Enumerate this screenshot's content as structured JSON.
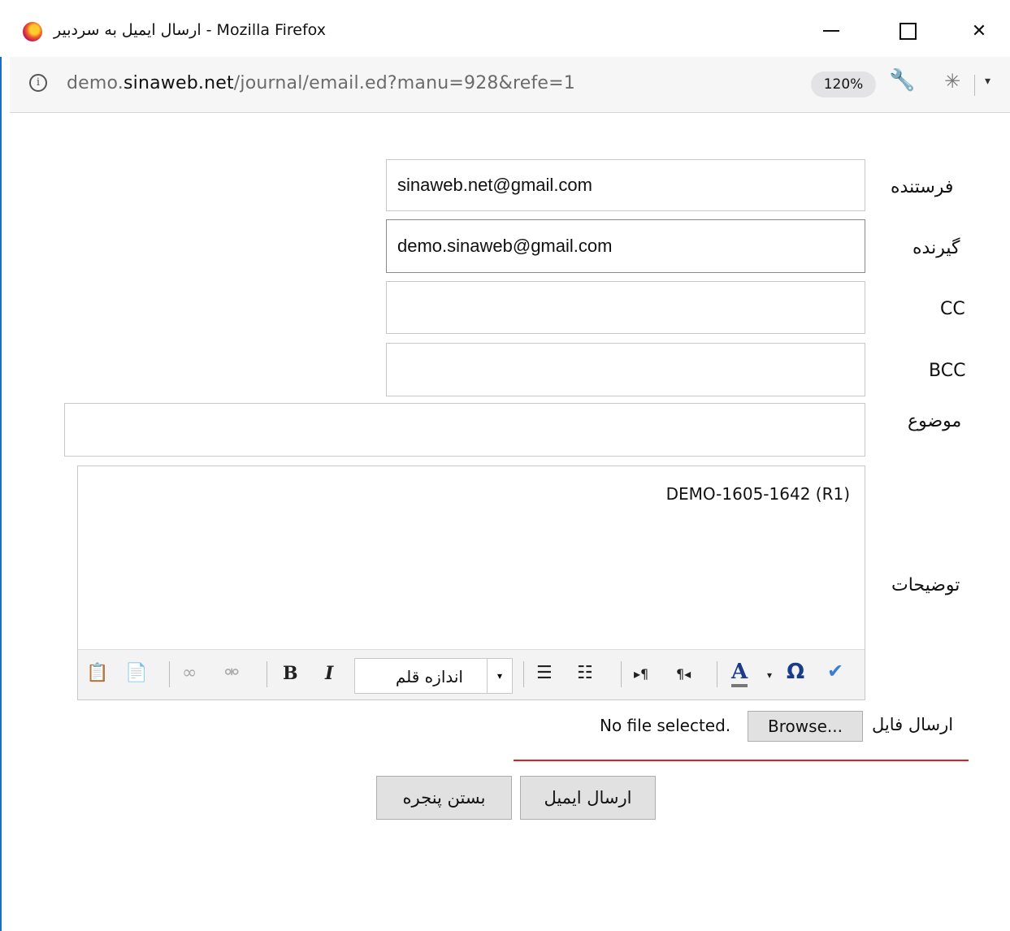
{
  "window": {
    "title": "ارسال ایمیل به سردبیر - Mozilla Firefox",
    "minimize_icon": "minimize-icon",
    "maximize_icon": "maximize-icon",
    "close_icon": "close-icon",
    "close_glyph": "✕"
  },
  "urlbar": {
    "info_glyph": "i",
    "host": "demo.sinaweb.net",
    "host_prefix": "demo.",
    "host_main": "sinaweb.net",
    "path": "/journal/email.ed?manu=928&refe=1",
    "zoom": "120%",
    "wrench_glyph": "🔧",
    "bug_glyph": "✳",
    "dropdown_glyph": "▾"
  },
  "form": {
    "sender_label": "فرستنده",
    "sender_value": "sinaweb.net@gmail.com",
    "recipient_label": "گیرنده",
    "recipient_value": "demo.sinaweb@gmail.com",
    "cc_label": "CC",
    "cc_value": "",
    "bcc_label": "BCC",
    "bcc_value": "",
    "subject_label": "موضوع",
    "subject_value": "",
    "description_label": "توضیحات",
    "description_value": "DEMO-1605-1642 (R1)",
    "font_size_label": "اندازه قلم",
    "attach_label": "ارسال فایل",
    "browse_label": "Browse...",
    "no_file_text": "No file selected."
  },
  "toolbar": {
    "paste_text_glyph": "📋",
    "paste_word_glyph": "📄",
    "link_glyph": "∞",
    "unlink_glyph": "⚮",
    "bold_glyph": "B",
    "italic_glyph": "I",
    "bullet_list_glyph": "☰",
    "numbered_list_glyph": "☷",
    "ltr_glyph": "▸¶",
    "rtl_glyph": "¶◂",
    "font_color_glyph": "A",
    "dropdown_glyph": "▾",
    "special_char_glyph": "Ω",
    "spellcheck_glyph": "✔"
  },
  "actions": {
    "send_label": "ارسال ایمیل",
    "close_label": "بستن پنجره"
  },
  "colors": {
    "accent_red": "#e02020",
    "window_border": "#1a6fc1"
  }
}
